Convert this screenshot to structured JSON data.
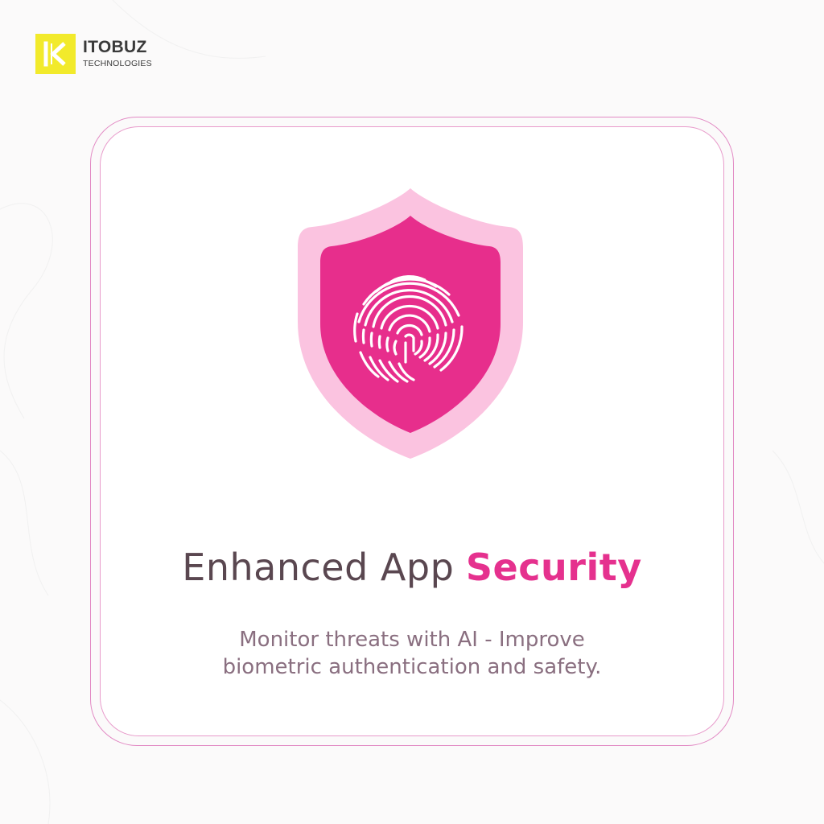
{
  "brand": {
    "name": "ITOBUZ",
    "tagline": "TECHNOLOGIES",
    "logo_color": "#f2ea2b"
  },
  "headline": {
    "main": "Enhanced App",
    "accent": "Security"
  },
  "description": {
    "line1": "Monitor threats with AI - Improve",
    "line2": "biometric authentication and safety."
  },
  "colors": {
    "accent": "#e5318e",
    "shield_outer": "#fbc3e0",
    "shield_inner": "#e72e8c",
    "card_border": "#e28ac4",
    "text_dark": "#5a4750",
    "text_muted": "#8a6f80"
  },
  "icons": {
    "shield": "shield-fingerprint-icon",
    "logo": "itobuz-logo-icon"
  }
}
